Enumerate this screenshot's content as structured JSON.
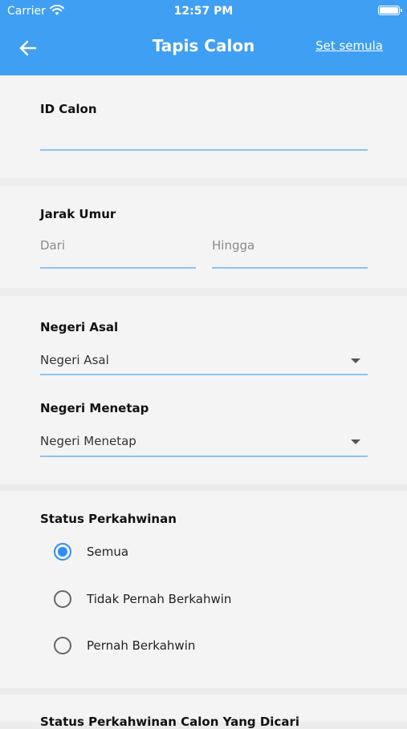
{
  "status_bar": {
    "carrier": "Carrier",
    "time": "12:57 PM"
  },
  "header": {
    "title": "Tapis Calon",
    "reset_label": "Set semula",
    "back_icon": "arrow-left-icon"
  },
  "id_calon": {
    "label": "ID Calon",
    "value": ""
  },
  "age_range": {
    "label": "Jarak Umur",
    "from_placeholder": "Dari",
    "to_placeholder": "Hingga"
  },
  "origin_state": {
    "label": "Negeri Asal",
    "selected": "Negeri Asal"
  },
  "resident_state": {
    "label": "Negeri Menetap",
    "selected": "Negeri Menetap"
  },
  "marital_status": {
    "label": "Status Perkahwinan",
    "options": [
      {
        "label": "Semua",
        "selected": true
      },
      {
        "label": "Tidak Pernah Berkahwin",
        "selected": false
      },
      {
        "label": "Pernah Berkahwin",
        "selected": false
      }
    ]
  },
  "desired_marital_status": {
    "label": "Status Perkahwinan Calon Yang Dicari"
  },
  "colors": {
    "primary": "#3f9ff2",
    "radio_active": "#2e8ef0",
    "underline": "#8cc3f4"
  }
}
